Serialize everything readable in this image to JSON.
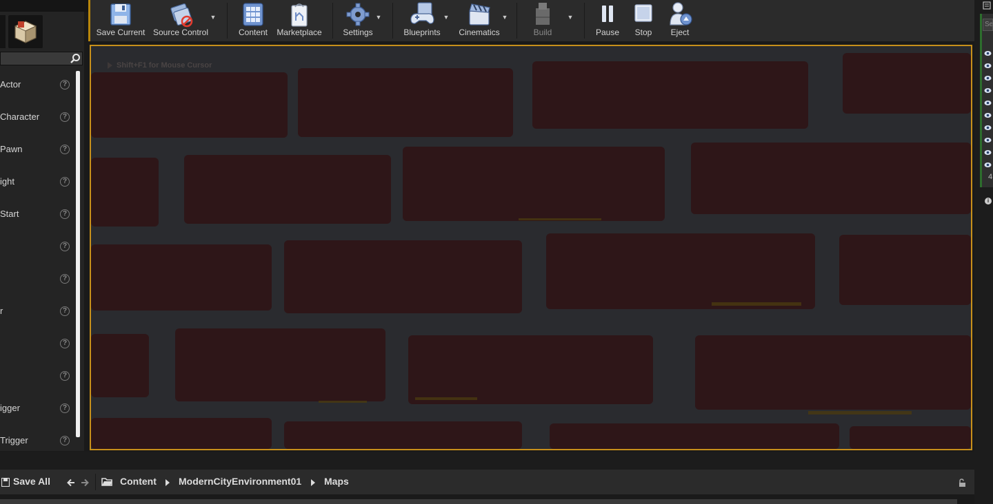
{
  "modes_panel": {
    "search_placeholder": "",
    "items": [
      {
        "label": "Actor"
      },
      {
        "label": "Character"
      },
      {
        "label": "Pawn"
      },
      {
        "label": "ight"
      },
      {
        "label": "Start"
      },
      {
        "label": ""
      },
      {
        "label": ""
      },
      {
        "label": "r"
      },
      {
        "label": ""
      },
      {
        "label": ""
      },
      {
        "label": "igger"
      },
      {
        "label": " Trigger"
      }
    ]
  },
  "toolbar": {
    "save_current": "Save Current",
    "source_control": "Source Control",
    "content": "Content",
    "marketplace": "Marketplace",
    "settings": "Settings",
    "blueprints": "Blueprints",
    "cinematics": "Cinematics",
    "build": "Build",
    "pause": "Pause",
    "stop": "Stop",
    "eject": "Eject"
  },
  "viewport": {
    "hint": "Shift+F1 for Mouse Cursor"
  },
  "outliner": {
    "search_placeholder": "Se",
    "count": "4"
  },
  "content_browser": {
    "save_all": "Save All",
    "breadcrumbs": [
      "Content",
      "ModernCityEnvironment01",
      "Maps"
    ]
  },
  "colors": {
    "viewport_border": "#c8901a",
    "accent_green": "#2d6e2d",
    "icon_blue": "#8fb4e8"
  }
}
